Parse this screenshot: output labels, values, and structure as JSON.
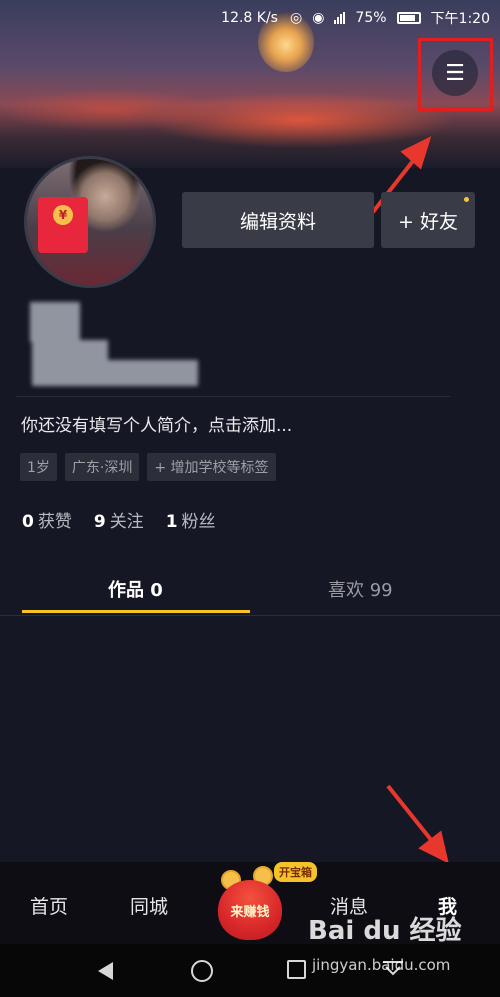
{
  "status_bar": {
    "net_speed": "12.8 K/s",
    "battery": "75%",
    "time": "下午1:20"
  },
  "profile": {
    "edit_label": "编辑资料",
    "add_friend_label": "+ 好友",
    "bio": "你还没有填写个人简介，点击添加...",
    "tags": [
      "1岁",
      "广东·深圳",
      "+ 增加学校等标签"
    ]
  },
  "stats": [
    {
      "value": "0",
      "label": "获赞"
    },
    {
      "value": "9",
      "label": "关注"
    },
    {
      "value": "1",
      "label": "粉丝"
    }
  ],
  "tabs": {
    "works": "作品 0",
    "likes": "喜欢 99"
  },
  "bottom_nav": {
    "home": "首页",
    "city": "同城",
    "earn": "来赚钱",
    "earn_badge": "开宝箱",
    "messages": "消息",
    "me": "我"
  },
  "watermark": {
    "brand": "Bai du 经验",
    "url": "jingyan.baidu.com"
  },
  "colors": {
    "background": "#161724",
    "tab_underline": "#f7c325",
    "highlight_red": "#e02020"
  },
  "icons": {
    "menu": "hamburger-menu-icon",
    "back": "triangle-back-icon",
    "home": "circle-home-icon",
    "recent": "square-recent-icon"
  }
}
